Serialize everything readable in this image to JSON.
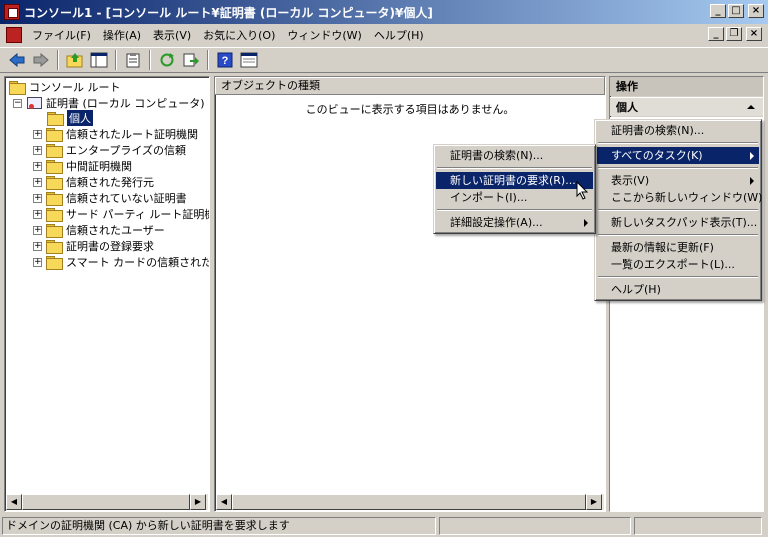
{
  "window": {
    "title": "コンソール1 - [コンソール ルート¥証明書 (ローカル コンピュータ)¥個人]"
  },
  "menubar": {
    "items": [
      "ファイル(F)",
      "操作(A)",
      "表示(V)",
      "お気に入り(O)",
      "ウィンドウ(W)",
      "ヘルプ(H)"
    ]
  },
  "toolbar": {
    "icons": [
      "back-arrow-icon",
      "forward-arrow-icon",
      "up-folder-icon",
      "show-hide-tree-icon",
      "clipboard-icon",
      "refresh-icon",
      "export-icon",
      "help-icon",
      "properties-icon"
    ]
  },
  "tree": {
    "root": "コンソール ルート",
    "cert_node": "証明書 (ローカル コンピュータ)",
    "selected": "個人",
    "children": [
      "信頼されたルート証明機関",
      "エンタープライズの信頼",
      "中間証明機関",
      "信頼された発行元",
      "信頼されていない証明書",
      "サード パーティ ルート証明機",
      "信頼されたユーザー",
      "証明書の登録要求",
      "スマート カードの信頼されたル"
    ]
  },
  "center": {
    "column_header": "オブジェクトの種類",
    "empty_message": "このビューに表示する項目はありません。"
  },
  "actions": {
    "header": "操作",
    "section": "個人"
  },
  "context_menu_main": {
    "items": [
      "証明書の検索(N)...",
      "すべてのタスク(K)",
      "表示(V)",
      "ここから新しいウィンドウ(W)",
      "新しいタスクパッド表示(T)...",
      "最新の情報に更新(F)",
      "一覧のエクスポート(L)...",
      "ヘルプ(H)"
    ]
  },
  "context_menu_sub": {
    "items": [
      "証明書の検索(N)...",
      "新しい証明書の要求(R)...",
      "インポート(I)...",
      "詳細設定操作(A)..."
    ]
  },
  "statusbar": {
    "message": "ドメインの証明機関 (CA) から新しい証明書を要求します"
  },
  "colors": {
    "title_start": "#0a246a",
    "title_end": "#a6caf0",
    "highlight": "#0a246a",
    "face": "#d4d0c8"
  }
}
